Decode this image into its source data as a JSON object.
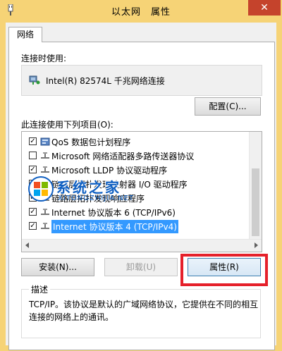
{
  "window": {
    "title": "以太网　属性",
    "close_glyph": "✕"
  },
  "tabs": [
    {
      "label": "网络"
    }
  ],
  "connect_using": {
    "label": "连接时使用:",
    "adapter_name": "Intel(R) 82574L 千兆网络连接"
  },
  "configure_button": "配置(C)...",
  "items_label": "此连接使用下列项目(O):",
  "items": [
    {
      "label": "QoS 数据包计划程序",
      "checked": true,
      "icon": "qos-icon"
    },
    {
      "label": "Microsoft 网络适配器多路传送器协议",
      "checked": false,
      "icon": "protocol-icon"
    },
    {
      "label": "Microsoft LLDP 协议驱动程序",
      "checked": true,
      "icon": "protocol-icon"
    },
    {
      "label": "链路层拓扑发现映射器 I/O 驱动程序",
      "checked": true,
      "icon": "protocol-icon"
    },
    {
      "label": "链路层拓扑发现响应程序",
      "checked": true,
      "icon": "protocol-icon"
    },
    {
      "label": "Internet 协议版本 6 (TCP/IPv6)",
      "checked": true,
      "icon": "protocol-icon"
    },
    {
      "label": "Internet 协议版本 4 (TCP/IPv4)",
      "checked": true,
      "icon": "protocol-icon",
      "selected": true
    }
  ],
  "buttons": {
    "install": "安装(N)...",
    "uninstall": "卸载(U)",
    "properties": "属性(R)"
  },
  "description": {
    "legend": "描述",
    "text": "TCP/IP。该协议是默认的广域网络协议，它提供在不同的相互连接的网络上的通讯。"
  },
  "watermark": {
    "text": "系统之家",
    "sub": "XITONGZHIJIA.NET"
  },
  "colors": {
    "titlebar": "#f6d376",
    "close": "#c5432c",
    "selection": "#3399ff",
    "highlight": "#e5202a"
  }
}
